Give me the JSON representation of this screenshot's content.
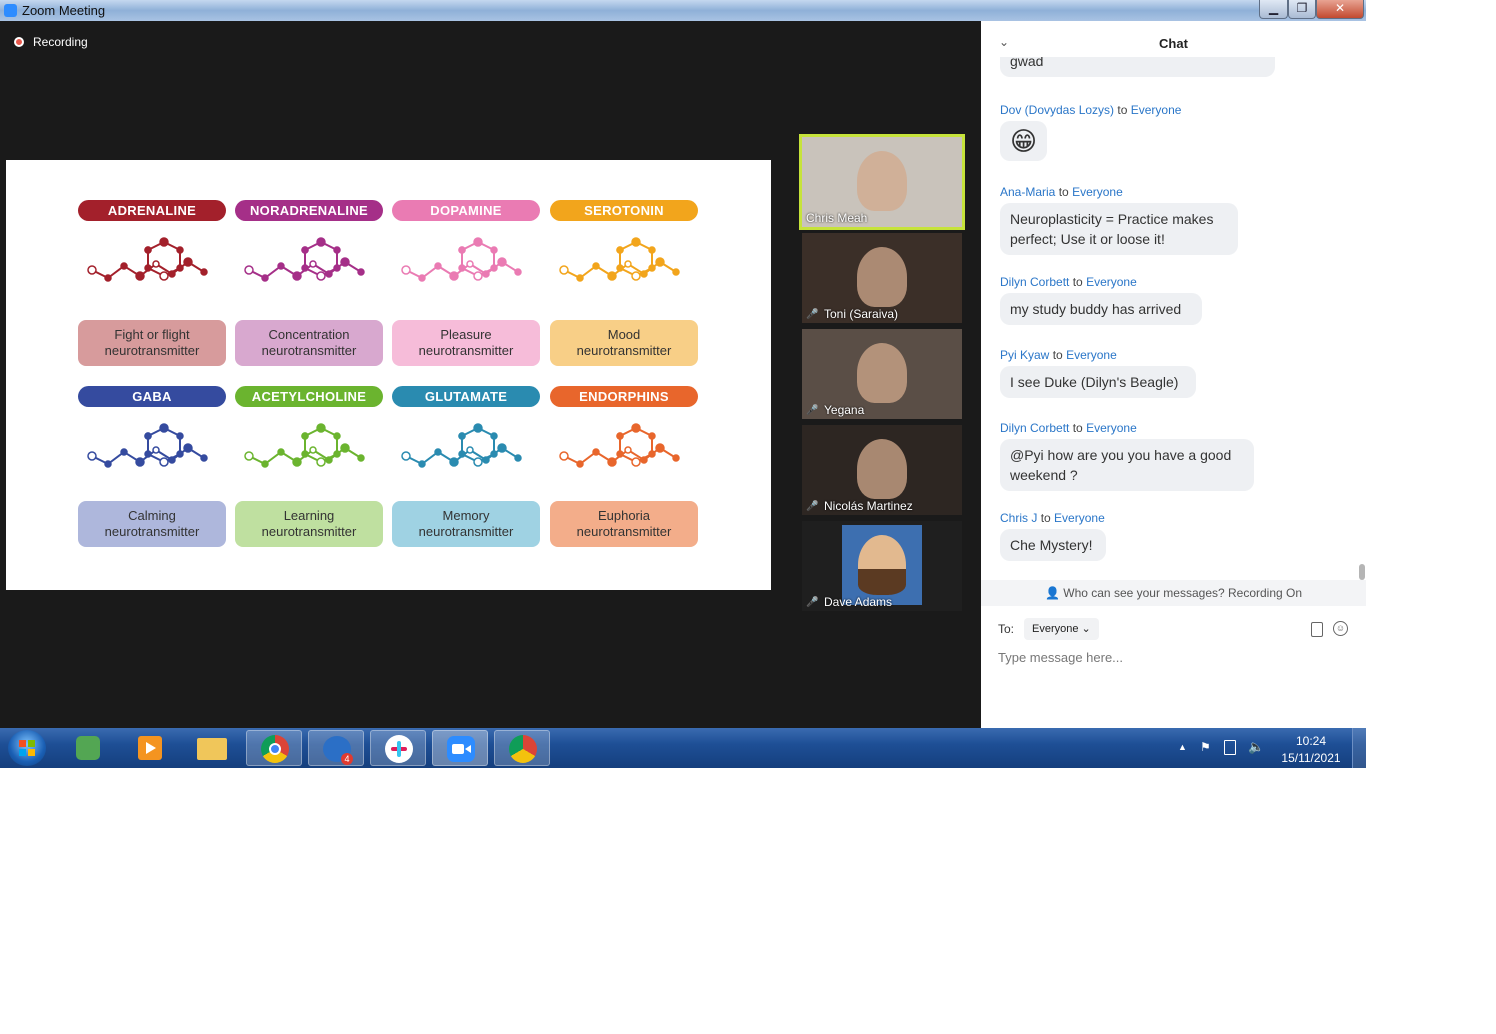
{
  "window": {
    "title": "Zoom Meeting",
    "minimize": "▁",
    "restore": "❐",
    "close": "✕"
  },
  "recording": {
    "label": "Recording"
  },
  "slide": {
    "rows": [
      [
        {
          "title": "ADRENALINE",
          "desc1": "Fight or flight",
          "desc2": "neurotransmitter",
          "color": "#a3202b",
          "card": "#d79b9c"
        },
        {
          "title": "NORADRENALINE",
          "desc1": "Concentration",
          "desc2": "neurotransmitter",
          "color": "#a52f88",
          "card": "#d8a8cf"
        },
        {
          "title": "DOPAMINE",
          "desc1": "Pleasure",
          "desc2": "neurotransmitter",
          "color": "#ea7bb3",
          "card": "#f6bcd9"
        },
        {
          "title": "SEROTONIN",
          "desc1": "Mood",
          "desc2": "neurotransmitter",
          "color": "#f2a51c",
          "card": "#f8cf87"
        }
      ],
      [
        {
          "title": "GABA",
          "desc1": "Calming",
          "desc2": "neurotransmitter",
          "color": "#354b9f",
          "card": "#aeb7dc"
        },
        {
          "title": "ACETYLCHOLINE",
          "desc1": "Learning",
          "desc2": "neurotransmitter",
          "color": "#6bb42f",
          "card": "#bfe0a0"
        },
        {
          "title": "GLUTAMATE",
          "desc1": "Memory",
          "desc2": "neurotransmitter",
          "color": "#2a8bb0",
          "card": "#9fd2e3"
        },
        {
          "title": "ENDORPHINS",
          "desc1": "Euphoria",
          "desc2": "neurotransmitter",
          "color": "#e8662c",
          "card": "#f3ad8a"
        }
      ]
    ]
  },
  "participants": [
    {
      "name": "Chris Meah",
      "active": true
    },
    {
      "name": "Toni (Saraiva)"
    },
    {
      "name": "Yegana"
    },
    {
      "name": "Nicolás Martinez"
    },
    {
      "name": "Dave Adams"
    }
  ],
  "chat": {
    "title": "Chat",
    "partial_top": "gwad",
    "messages": [
      {
        "from": "Dov (Dovydas Lozys)",
        "to_word": "to",
        "to": "Everyone",
        "text": "😁"
      },
      {
        "from": "Ana-Maria",
        "to_word": "to",
        "to": "Everyone",
        "text": "Neuroplasticity = Practice makes perfect; Use it or loose it!"
      },
      {
        "from": "Dilyn Corbett",
        "to_word": "to",
        "to": "Everyone",
        "text": "my study buddy has arrived"
      },
      {
        "from": "Pyi Kyaw",
        "to_word": "to",
        "to": "Everyone",
        "text": "I see Duke (Dilyn's Beagle)"
      },
      {
        "from": "Dilyn Corbett",
        "to_word": "to",
        "to": "Everyone",
        "text": "@Pyi how are you you have a good weekend ?"
      },
      {
        "from": "Chris J",
        "to_word": "to",
        "to": "Everyone",
        "text": "Che Mystery!"
      }
    ],
    "visibility_note": "Who can see your messages? Recording On",
    "to_label": "To:",
    "to_value": "Everyone",
    "placeholder": "Type message here..."
  },
  "taskbar": {
    "apps": [
      "start",
      "evernote",
      "media-player",
      "file-explorer",
      "chrome",
      "mail",
      "slack",
      "zoom",
      "chrome-profile"
    ],
    "mail_badge": "4",
    "time": "10:24",
    "date": "15/11/2021"
  }
}
